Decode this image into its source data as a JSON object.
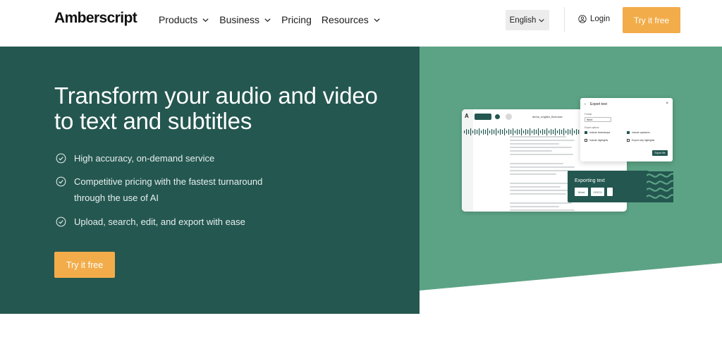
{
  "brand": {
    "logo": "Amberscript"
  },
  "nav": {
    "items": [
      {
        "label": "Products",
        "has_dropdown": true
      },
      {
        "label": "Business",
        "has_dropdown": true
      },
      {
        "label": "Pricing",
        "has_dropdown": false
      },
      {
        "label": "Resources",
        "has_dropdown": true
      }
    ],
    "language": "English",
    "login": "Login",
    "cta": "Try it free"
  },
  "hero": {
    "headline": "Transform your audio and video to text and subtitles",
    "features": [
      "High accuracy, on-demand service",
      "Competitive pricing with the fastest turnaround through the use of AI",
      "Upload, search, edit, and export with ease"
    ],
    "cta": "Try it free"
  },
  "mockup": {
    "file_name": "demo_english_final.wav",
    "export_panel": {
      "title": "Export text",
      "format_label": "Format",
      "format_value": "Word",
      "options_label": "Export options",
      "options": [
        {
          "label": "Include timestamps",
          "checked": true
        },
        {
          "label": "Include speakers",
          "checked": true
        },
        {
          "label": "Include highlights",
          "checked": false
        },
        {
          "label": "Export only highlights",
          "checked": false
        }
      ],
      "button": "Export file"
    },
    "exporting": {
      "title": "Exporting text",
      "chips": [
        "Word",
        ".DOCX",
        ""
      ]
    }
  },
  "colors": {
    "brand_green": "#235750",
    "accent_green": "#5ca285",
    "cta_orange": "#f2ad4a"
  }
}
